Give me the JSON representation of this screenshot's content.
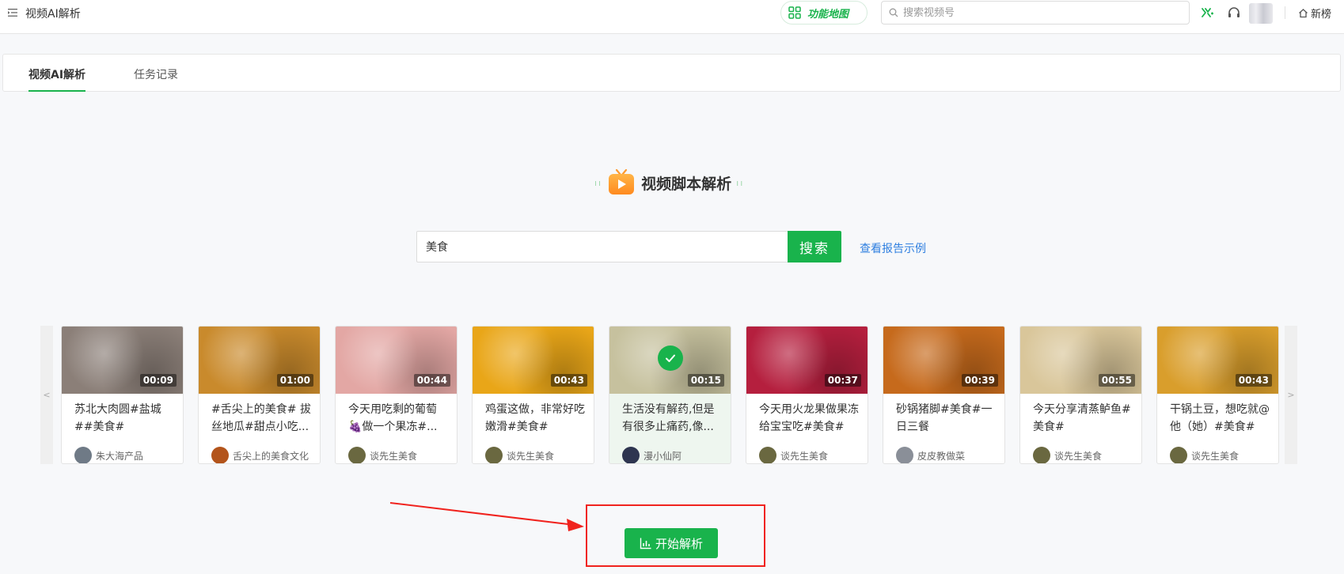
{
  "header": {
    "title": "视频AI解析",
    "function_map_label": "功能地图",
    "search_placeholder": "搜索视频号",
    "rank_label": "新榜"
  },
  "tabs": [
    {
      "label": "视频AI解析",
      "active": true
    },
    {
      "label": "任务记录",
      "active": false
    }
  ],
  "section": {
    "heading": "视频脚本解析",
    "search_value": "美食",
    "search_button": "搜索",
    "example_link": "查看报告示例"
  },
  "carousel": {
    "prev_label": "<",
    "next_label": ">",
    "videos": [
      {
        "title": "苏北大肉圆#盐城##美食#",
        "duration": "00:09",
        "author": "朱大海产品",
        "selected": false,
        "thumb_color": "#8b7f78",
        "avatar_color": "#6f7a86"
      },
      {
        "title": "#舌尖上的美食# 拔丝地瓜#甜点小吃...",
        "duration": "01:00",
        "author": "舌尖上的美食文化",
        "selected": false,
        "thumb_color": "#c98a2c",
        "avatar_color": "#b3541b"
      },
      {
        "title": "今天用吃剩的葡萄🍇做一个果冻#...",
        "duration": "00:44",
        "author": "谈先生美食",
        "selected": false,
        "thumb_color": "#e3a7a4",
        "avatar_color": "#6a6840"
      },
      {
        "title": "鸡蛋这做，非常好吃嫩滑#美食#",
        "duration": "00:43",
        "author": "谈先生美食",
        "selected": false,
        "thumb_color": "#e9a618",
        "avatar_color": "#6a6840"
      },
      {
        "title": "生活没有解药,但是有很多止痛药,像...",
        "duration": "00:15",
        "author": "漫小仙阿",
        "selected": true,
        "thumb_color": "#c6c19e",
        "avatar_color": "#2e3550"
      },
      {
        "title": "今天用火龙果做果冻给宝宝吃#美食#",
        "duration": "00:37",
        "author": "谈先生美食",
        "selected": false,
        "thumb_color": "#b51f3e",
        "avatar_color": "#6a6840"
      },
      {
        "title": "砂锅猪脚#美食#一日三餐",
        "duration": "00:39",
        "author": "皮皮教做菜",
        "selected": false,
        "thumb_color": "#c66a1c",
        "avatar_color": "#8a8f98"
      },
      {
        "title": "今天分享清蒸鲈鱼#美食#",
        "duration": "00:55",
        "author": "谈先生美食",
        "selected": false,
        "thumb_color": "#d9c69a",
        "avatar_color": "#6a6840"
      },
      {
        "title": "干锅土豆，想吃就@他（她）#美食#",
        "duration": "00:43",
        "author": "谈先生美食",
        "selected": false,
        "thumb_color": "#d99e2c",
        "avatar_color": "#6a6840"
      }
    ]
  },
  "start_button": "开始解析",
  "colors": {
    "accent": "#19b34c",
    "link": "#2f7fe0",
    "annotation": "#f0231e"
  }
}
